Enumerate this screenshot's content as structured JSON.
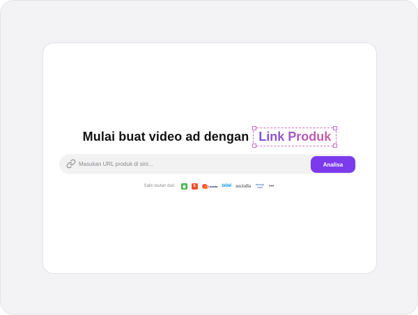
{
  "headline": {
    "text": "Mulai buat video ad dengan",
    "accent": "Link Produk"
  },
  "search": {
    "placeholder": "Masukan URL produk di sini...",
    "value": "",
    "button_label": "Analisa"
  },
  "sources": {
    "label": "Salin tautan dari:",
    "marketplaces": [
      {
        "icon": "tokopedia-logo",
        "text": ""
      },
      {
        "icon": "shopee-logo",
        "text": "S"
      },
      {
        "icon": "lazada-logo",
        "text": "Lazada"
      },
      {
        "icon": "blibli-logo",
        "text": "blibli"
      },
      {
        "icon": "sociolla-logo",
        "text": "sociolla"
      },
      {
        "icon": "beautyhaul-logo",
        "text": "beauty haul"
      }
    ],
    "more_label": "•••"
  },
  "colors": {
    "accent_gradient_start": "#7b4fe6",
    "accent_gradient_end": "#d0609c",
    "button_bg": "#7c3aed",
    "outer_bg": "#f3f3f6",
    "card_bg": "#ffffff"
  }
}
